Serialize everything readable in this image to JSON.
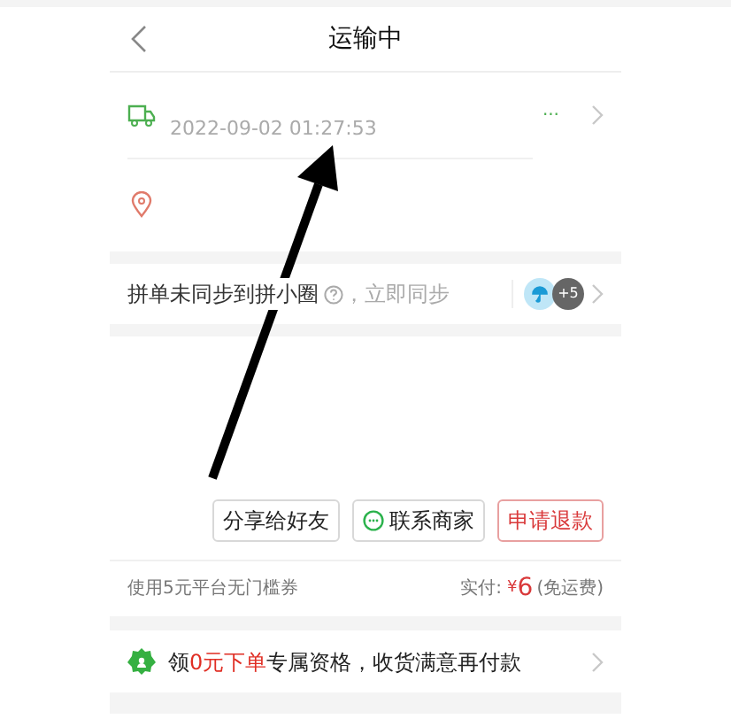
{
  "header": {
    "title": "运输中"
  },
  "shipping": {
    "status": "...",
    "time": "2022-09-02 01:27:53"
  },
  "sync": {
    "text": "拼单未同步到拼小圈",
    "action": "，立即同步",
    "extra_count": "+5"
  },
  "buttons": [
    {
      "label": "分享给好友",
      "kind": "plain"
    },
    {
      "label": "联系商家",
      "kind": "chat"
    },
    {
      "label": "申请退款",
      "kind": "danger"
    }
  ],
  "payment": {
    "coupon": "使用5元平台无门槛券",
    "paid_label": "实付:",
    "currency": "¥",
    "amount": "6",
    "note": "(免运费)"
  },
  "promo": {
    "parts": [
      {
        "text": "领",
        "highlight": false
      },
      {
        "text": "0元下单",
        "highlight": true
      },
      {
        "text": "专属资格，收货满意再付款",
        "highlight": false
      }
    ]
  }
}
